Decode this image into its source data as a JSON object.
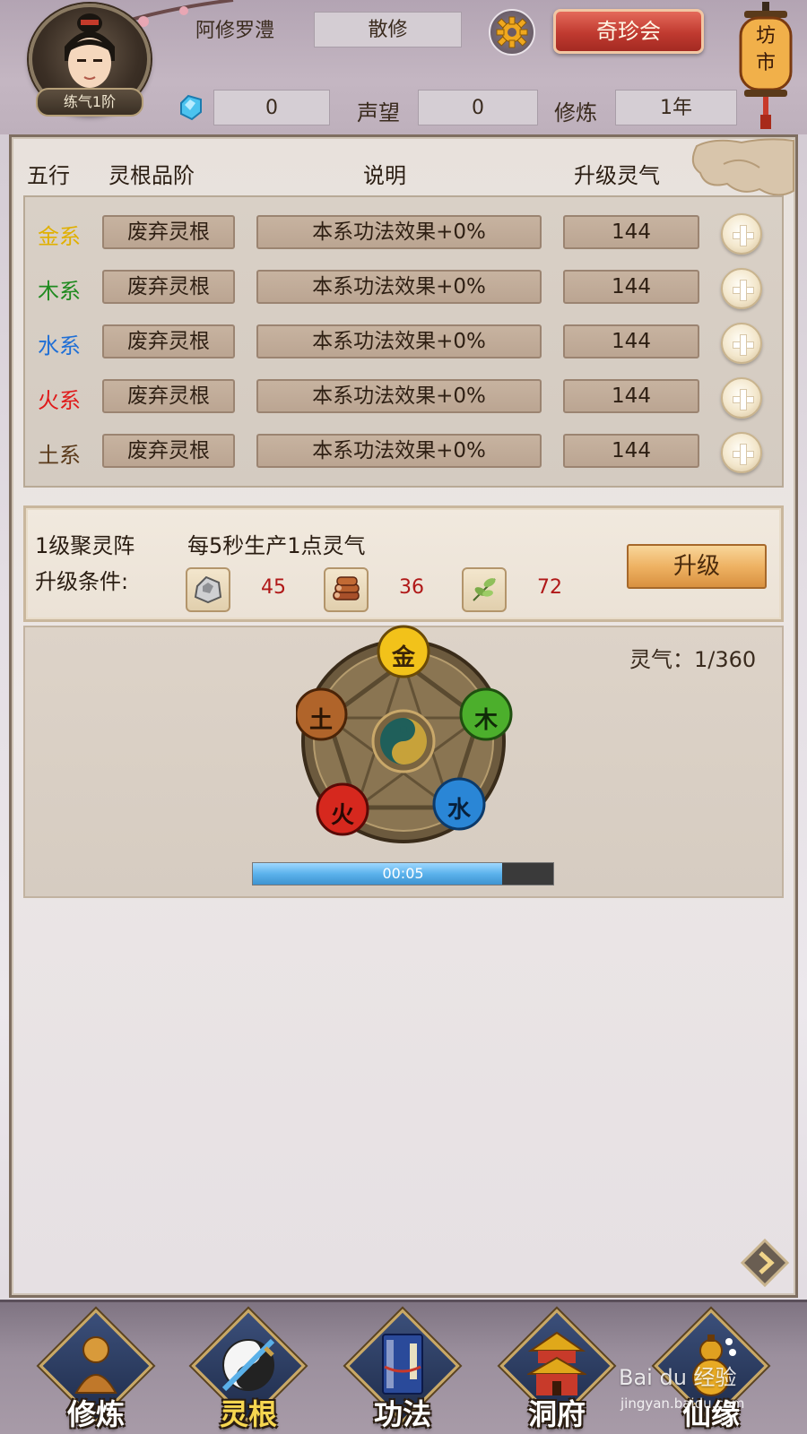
{
  "header": {
    "player_name": "阿修罗澧",
    "sect": "散修",
    "rank_badge": "练气1阶",
    "shop_button": "奇珍会",
    "market_lantern": "坊市",
    "gem_count": "0",
    "reputation_label": "声望",
    "reputation_value": "0",
    "cultivation_label": "修炼",
    "cultivation_value": "1年"
  },
  "roots_table": {
    "headers": [
      "五行",
      "灵根品阶",
      "说明",
      "升级灵气"
    ],
    "rows": [
      {
        "element": "金系",
        "color": "#e0b000",
        "grade": "废弃灵根",
        "desc": "本系功法效果+0%",
        "cost": "144"
      },
      {
        "element": "木系",
        "color": "#1f8a1f",
        "grade": "废弃灵根",
        "desc": "本系功法效果+0%",
        "cost": "144"
      },
      {
        "element": "水系",
        "color": "#1f6fd6",
        "grade": "废弃灵根",
        "desc": "本系功法效果+0%",
        "cost": "144"
      },
      {
        "element": "火系",
        "color": "#e01a1a",
        "grade": "废弃灵根",
        "desc": "本系功法效果+0%",
        "cost": "144"
      },
      {
        "element": "土系",
        "color": "#5a3a1a",
        "grade": "废弃灵根",
        "desc": "本系功法效果+0%",
        "cost": "144"
      }
    ]
  },
  "gathering_array": {
    "title": "1级聚灵阵",
    "description": "每5秒生产1点灵气",
    "condition_label": "升级条件:",
    "materials": [
      {
        "icon": "stone-icon",
        "count": "45"
      },
      {
        "icon": "wood-icon",
        "count": "36"
      },
      {
        "icon": "herb-icon",
        "count": "72"
      }
    ],
    "upgrade_button": "升级"
  },
  "formation": {
    "qi_text": "灵气：1/360",
    "elements": [
      "金",
      "木",
      "水",
      "火",
      "土"
    ],
    "timer": "00:05",
    "progress": 0.83
  },
  "bottom_nav": [
    {
      "label": "修炼",
      "active": false
    },
    {
      "label": "灵根",
      "active": true
    },
    {
      "label": "功法",
      "active": false
    },
    {
      "label": "洞府",
      "active": false
    },
    {
      "label": "仙缘",
      "active": false
    }
  ],
  "watermark": {
    "main": "Bai du 经验",
    "sub": "jingyan.baidu.com"
  }
}
